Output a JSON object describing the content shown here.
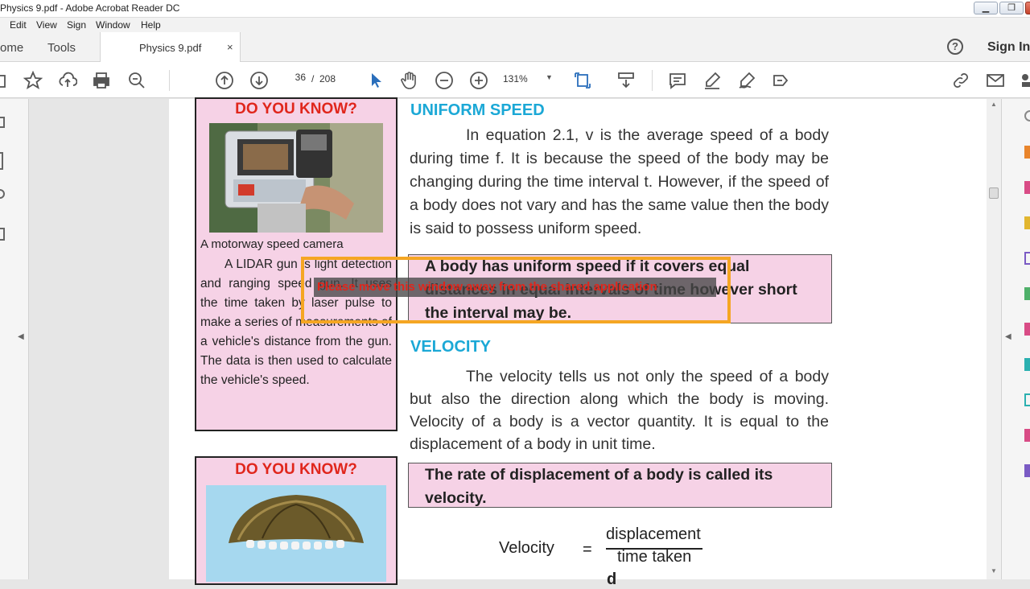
{
  "window": {
    "title": "Physics 9.pdf - Adobe Acrobat Reader DC",
    "controls": {
      "minimize": "▁",
      "restore": "❐",
      "close": "✕"
    }
  },
  "menu": {
    "items": [
      "Edit",
      "View",
      "Sign",
      "Window",
      "Help"
    ]
  },
  "tabs": {
    "home": "ome",
    "tools": "Tools",
    "document": "Physics 9.pdf",
    "close": "×"
  },
  "account": {
    "sign_in": "Sign In",
    "help": "?"
  },
  "toolbar": {
    "page_current": "36",
    "page_separator": "/",
    "page_total": "208",
    "zoom": "131%",
    "icons": [
      "star-icon",
      "upload-icon",
      "print-icon",
      "zoom-search-icon",
      "page-up-icon",
      "page-down-icon",
      "select-pointer-icon",
      "hand-icon",
      "zoom-out-icon",
      "zoom-in-icon",
      "page-fit-icon",
      "scroll-mode-icon",
      "comment-icon",
      "highlight-icon",
      "sign-icon",
      "stamp-icon",
      "share-link-icon",
      "email-icon"
    ]
  },
  "document": {
    "box1": {
      "heading": "DO YOU KNOW?",
      "caption": "A motorway speed camera",
      "paragraph": "A LIDAR gun is light detection and ranging speed gun. It uses the time taken by laser pulse to make a series of measurements of a vehicle's distance from the gun. The data is then used to calculate the vehicle's speed."
    },
    "box2": {
      "heading": "DO YOU KNOW?"
    },
    "uniform_speed": {
      "heading": "UNIFORM SPEED",
      "paragraph": "In equation 2.1, v is the average speed of a body during time f. It is because the speed of the body may be changing during the time interval t. However, if the speed of a body does not vary and has the same value then the body is said to possess uniform speed.",
      "definition": "A body has uniform speed if it covers equal distances in equal intervals of time however short the interval may be."
    },
    "velocity": {
      "heading": "VELOCITY",
      "paragraph": "The velocity tells us not only the speed of a body but also the direction along which the body is moving. Velocity of a body is a vector quantity. It is equal to the displacement of a body in unit time.",
      "definition": "The rate of displacement of a body is called its velocity.",
      "formula_lhs": "Velocity",
      "formula_eq": "=",
      "formula_num": "displacement",
      "formula_den": "time taken",
      "formula_next": "d"
    }
  },
  "overlay": {
    "message": "Please move this window away from the shared application"
  }
}
